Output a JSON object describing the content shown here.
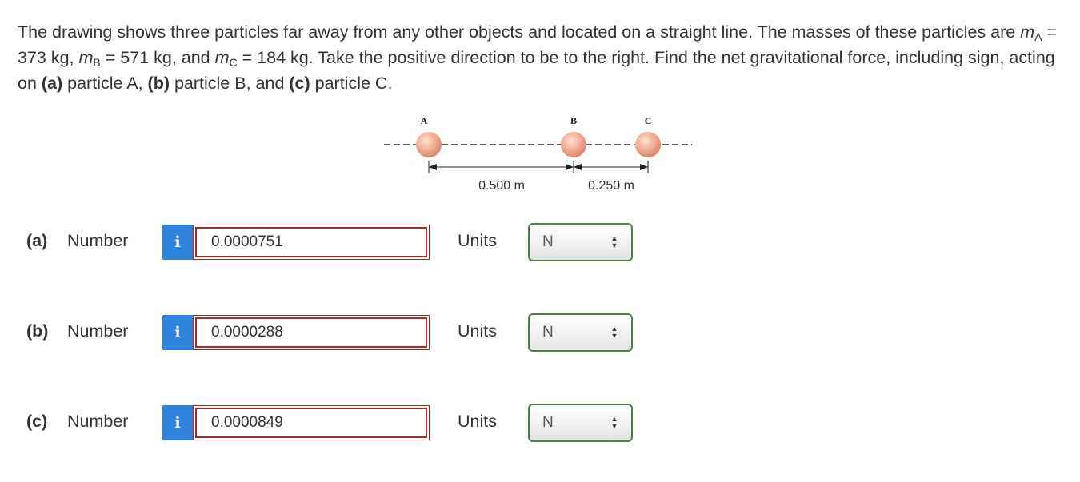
{
  "question": {
    "intro": "The drawing shows three particles far away from any other objects and located on a straight line. The masses of these particles are ",
    "mA_sym": "m",
    "mA_sub": "A",
    "mA_val": " = 373 kg, ",
    "mB_sym": "m",
    "mB_sub": "B",
    "mB_val": " = 571 kg, and ",
    "mC_sym": "m",
    "mC_sub": "C",
    "mC_val": " = 184 kg. Take the positive direction to be to the right. Find the net gravitational force, including sign, acting on ",
    "part_a": "(a)",
    "text_a": " particle A, ",
    "part_b": "(b)",
    "text_b": " particle B, and ",
    "part_c": "(c)",
    "text_c": " particle C."
  },
  "diagram": {
    "label_a": "A",
    "label_b": "B",
    "label_c": "C",
    "distance_ab": "0.500 m",
    "distance_bc": "0.250 m"
  },
  "answers": [
    {
      "part": "(a)",
      "number_label": "Number",
      "info": "i",
      "value": "0.0000751",
      "units_label": "Units",
      "unit": "N"
    },
    {
      "part": "(b)",
      "number_label": "Number",
      "info": "i",
      "value": "0.0000288",
      "units_label": "Units",
      "unit": "N"
    },
    {
      "part": "(c)",
      "number_label": "Number",
      "info": "i",
      "value": "0.0000849",
      "units_label": "Units",
      "unit": "N"
    }
  ],
  "colors": {
    "info_button": "#2e84df",
    "answer_border": "#a32a2a",
    "select_border": "#4d7f4a",
    "sphere": "#f0a58c"
  }
}
